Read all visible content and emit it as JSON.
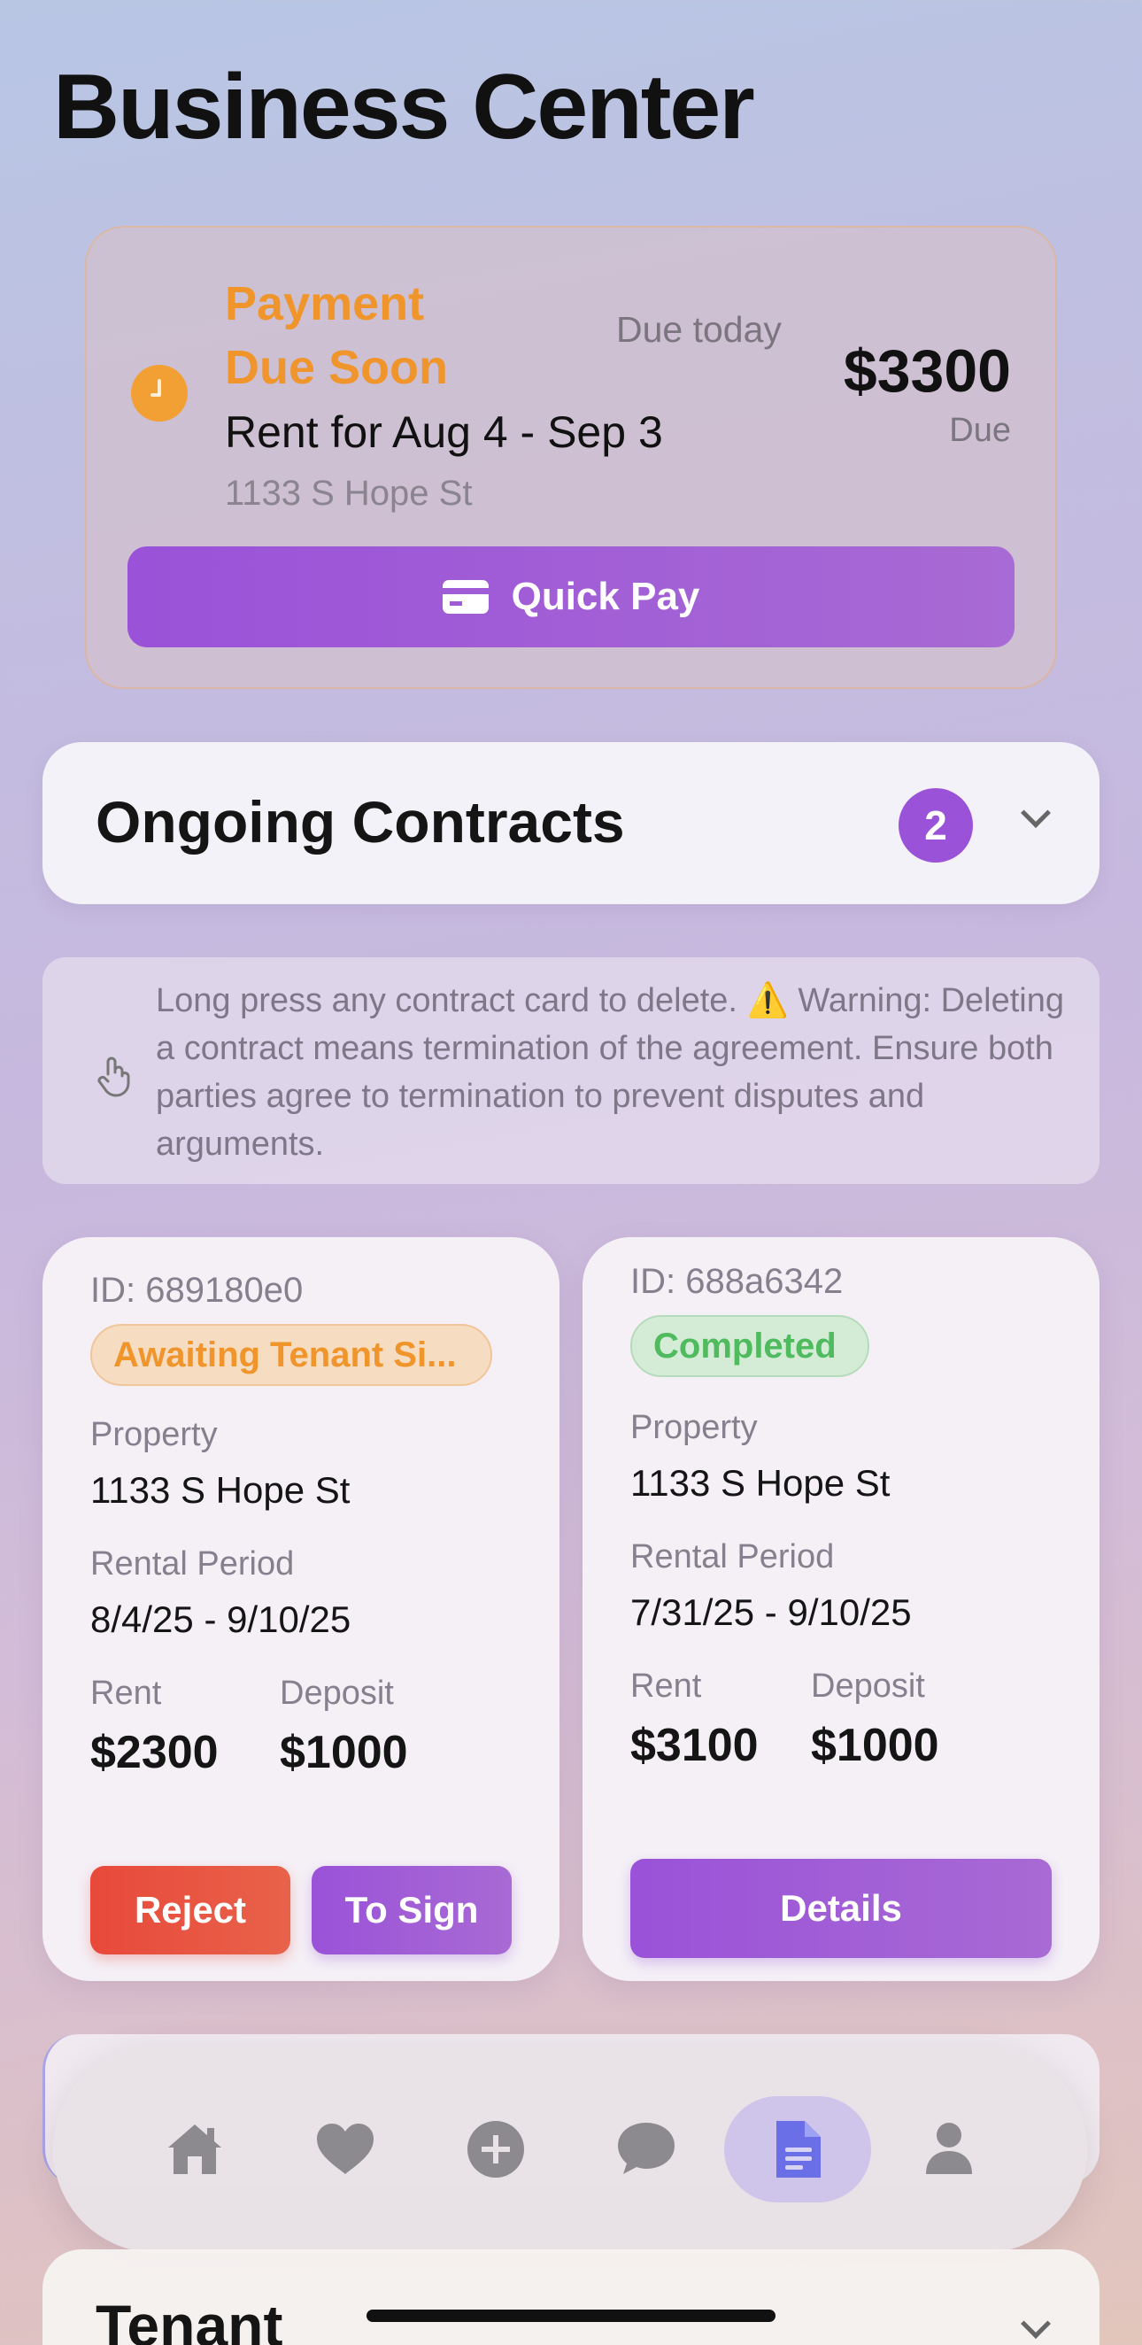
{
  "header": {
    "title": "Business Center"
  },
  "payment": {
    "status": "Payment Due Soon",
    "due_label": "Due today",
    "amount": "$3300",
    "amount_suffix": "Due",
    "description": "Rent for Aug 4 - Sep 3",
    "address": "1133 S Hope St",
    "quick_pay_label": "Quick Pay",
    "status_color": "#f0952c",
    "accent_color": "#9a52d8"
  },
  "contracts": {
    "title": "Ongoing Contracts",
    "count": "2",
    "hint": "Long press any contract card to delete. ⚠️ Warning: Deleting a contract means termination of the agreement. Ensure both parties agree to termination to prevent disputes and arguments.",
    "labels": {
      "property": "Property",
      "rental_period": "Rental Period",
      "rent": "Rent",
      "deposit": "Deposit"
    },
    "cards": [
      {
        "id": "ID: 689180e0",
        "status": "Awaiting Tenant Si...",
        "property": "1133 S Hope St",
        "rental_period": "8/4/25 - 9/10/25",
        "rent": "$2300",
        "deposit": "$1000",
        "actions": {
          "reject": "Reject",
          "sign": "To Sign"
        }
      },
      {
        "id": "ID: 688a6342",
        "status": "Completed",
        "property": "1133 S Hope St",
        "rental_period": "7/31/25 - 9/10/25",
        "rent": "$3100",
        "deposit": "$1000",
        "actions": {
          "details": "Details"
        }
      }
    ]
  },
  "tenant": {
    "title": "Tenant"
  },
  "tabbar": {
    "items": [
      {
        "icon": "home-icon",
        "active": false
      },
      {
        "icon": "heart-icon",
        "active": false
      },
      {
        "icon": "plus-circle-icon",
        "active": false
      },
      {
        "icon": "chat-bubble-icon",
        "active": false
      },
      {
        "icon": "document-icon",
        "active": true
      },
      {
        "icon": "person-icon",
        "active": false
      }
    ],
    "active_color": "#6a6fe8",
    "inactive_color": "#8c8a8e"
  }
}
